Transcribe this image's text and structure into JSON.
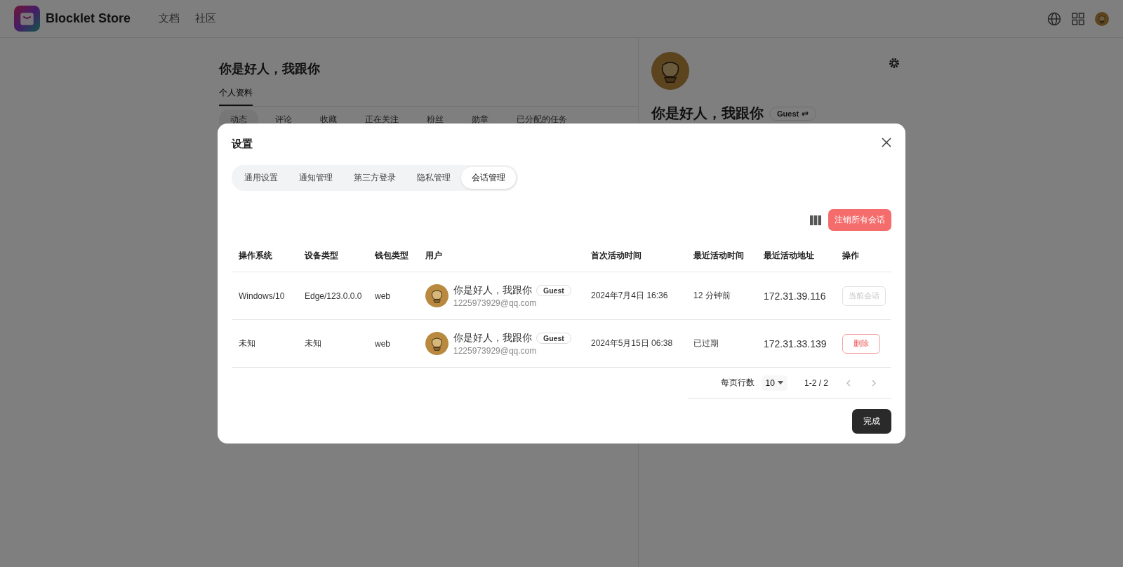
{
  "header": {
    "brand": "Blocklet Store",
    "nav": [
      "文档",
      "社区"
    ]
  },
  "profile": {
    "name": "你是好人，我跟你",
    "tabs": [
      {
        "label": "个人资料",
        "selected": true
      }
    ],
    "subtabs": [
      {
        "label": "动态",
        "selected": true
      },
      {
        "label": "评论",
        "selected": false
      },
      {
        "label": "收藏",
        "selected": false
      },
      {
        "label": "正在关注",
        "selected": false
      },
      {
        "label": "粉丝",
        "selected": false
      },
      {
        "label": "勋章",
        "selected": false
      },
      {
        "label": "已分配的任务",
        "selected": false
      }
    ]
  },
  "side": {
    "name": "你是好人，我跟你",
    "badge": "Guest"
  },
  "dialog": {
    "title": "设置",
    "tabs": [
      {
        "label": "通用设置",
        "selected": false
      },
      {
        "label": "通知管理",
        "selected": false
      },
      {
        "label": "第三方登录",
        "selected": false
      },
      {
        "label": "隐私管理",
        "selected": false
      },
      {
        "label": "会话管理",
        "selected": true
      }
    ],
    "revoke_button": "注销所有会话",
    "table": {
      "columns": [
        "操作系统",
        "设备类型",
        "钱包类型",
        "用户",
        "首次活动时间",
        "最近活动时间",
        "最近活动地址",
        "操作"
      ],
      "rows": [
        {
          "os": "Windows/10",
          "device": "Edge/123.0.0.0",
          "wallet": "web",
          "user": {
            "name": "你是好人，我跟你",
            "badge": "Guest",
            "email": "1225973929@qq.com"
          },
          "first_active": "2024年7月4日 16:36",
          "last_active": "12 分钟前",
          "address": "172.31.39.116",
          "action": {
            "label": "当前会话",
            "disabled": true
          }
        },
        {
          "os": "未知",
          "device": "未知",
          "wallet": "web",
          "user": {
            "name": "你是好人，我跟你",
            "badge": "Guest",
            "email": "1225973929@qq.com"
          },
          "first_active": "2024年5月15日 06:38",
          "last_active": "已过期",
          "address": "172.31.33.139",
          "action": {
            "label": "删除",
            "disabled": false
          }
        }
      ]
    },
    "pagination": {
      "rows_per_page_label": "每页行数",
      "rows_per_page": "10",
      "range": "1-2 / 2"
    },
    "done_button": "完成"
  }
}
